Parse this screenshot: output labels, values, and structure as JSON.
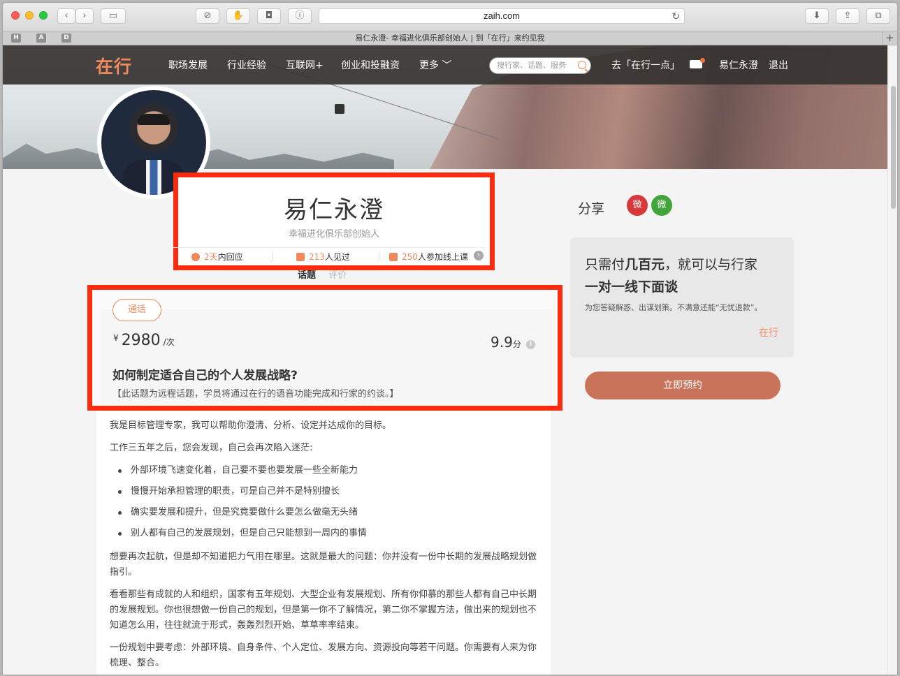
{
  "browser": {
    "url": "zaih.com",
    "tab_title": "易仁永澄- 幸福进化俱乐部创始人 | 到「在行」来约见我",
    "favorites": [
      "H",
      "A",
      "D"
    ],
    "new_tab": "+"
  },
  "nav": {
    "logo": "在行",
    "items": [
      "职场发展",
      "行业经验",
      "互联网+",
      "创业和投融资",
      "更多 ﹀"
    ],
    "search_placeholder": "搜行家、话题、服务",
    "yidian_link": "去「在行一点」",
    "user_name": "易仁永澄",
    "logout": "退出"
  },
  "profile": {
    "name": "易仁永澄",
    "title": "幸福进化俱乐部创始人",
    "stats": [
      {
        "num": "2天",
        "label": "内回应"
      },
      {
        "num": "213",
        "label": "人见过"
      },
      {
        "num": "250",
        "label": "人参加线上课"
      }
    ],
    "tabs": [
      "话题",
      "评价"
    ]
  },
  "share": {
    "label": "分享",
    "weibo": "微",
    "wechat": "微"
  },
  "topic": {
    "type_button": "通话",
    "currency": "¥",
    "price": "2980",
    "price_unit": "/次",
    "score": "9.9",
    "score_unit": "分",
    "info": "i",
    "title": "如何制定适合自己的个人发展战略?",
    "note": "【此话题为远程话题，学员将通过在行的语音功能完成和行家的约谈。】"
  },
  "description": {
    "p1": "我是目标管理专家，我可以帮助你澄清、分析、设定并达成你的目标。",
    "p2": "工作三五年之后，您会发现，自己会再次陷入迷茫:",
    "bullets": [
      "外部环境飞速变化着，自己要不要也要发展一些全新能力",
      "慢慢开始承担管理的职责，可是自己并不是特别擅长",
      "确实要发展和提升，但是究竟要做什么要怎么做毫无头绪",
      "别人都有自己的发展规划，但是自己只能想到一周内的事情"
    ],
    "p3": "想要再次起航，但是却不知道把力气用在哪里。这就是最大的问题：你并没有一份中长期的发展战略规划做指引。",
    "p4": "看看那些有成就的人和组织，国家有五年规划、大型企业有发展规划、所有你仰慕的那些人都有自己中长期的发展规划。你也很想做一份自己的规划，但是第一你不了解情况，第二你不掌握方法，做出来的规划也不知道怎么用，往往就流于形式，轰轰烈烈开始、草草率率结束。",
    "p5": "一份规划中要考虑：外部环境、自身条件、个人定位、发展方向、资源投向等若干问题。你需要有人来为你梳理、整合。"
  },
  "promo": {
    "line1_pre": "只需付",
    "line1_bold": "几百元",
    "line1_post": "，就可以与行家",
    "line2": "一对一线下面谈",
    "sub": "为您答疑解惑、出谋划策。不满意还能“无忧退款”。",
    "link": "在行"
  },
  "book_button": "立即预约",
  "colors": {
    "accent": "#f08a5d",
    "highlight_box": "#fe2b0f",
    "book_button": "#c9745a"
  }
}
